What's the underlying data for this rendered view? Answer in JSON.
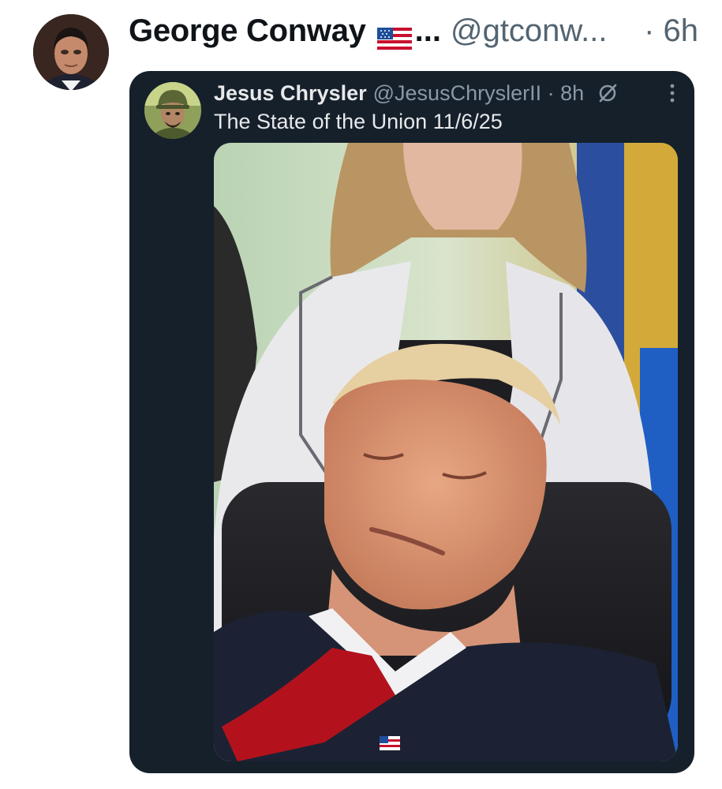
{
  "tweet": {
    "author_name": "George Conway",
    "author_emoji": "us-flag-emoji",
    "truncation": "...",
    "handle": "@gtconw...",
    "time": "· 6h",
    "avatar": "profile-photo"
  },
  "quote": {
    "author_name": "Jesus Chrysler",
    "handle": "@JesusChryslerII · 8h",
    "badge_icon": "grok-icon",
    "menu_icon": "more-vertical-icon",
    "text": "The State of the Union  11/6/25",
    "media": "photo-of-man-sleeping-in-chair-with-woman-standing-behind",
    "avatar": "profile-photo-helmet"
  },
  "colors": {
    "card_background": "#15202b",
    "primary_text_dark": "#0f1419",
    "secondary_text": "#536471",
    "card_text": "#e7e9ea",
    "card_secondary_text": "#8b98a5"
  }
}
